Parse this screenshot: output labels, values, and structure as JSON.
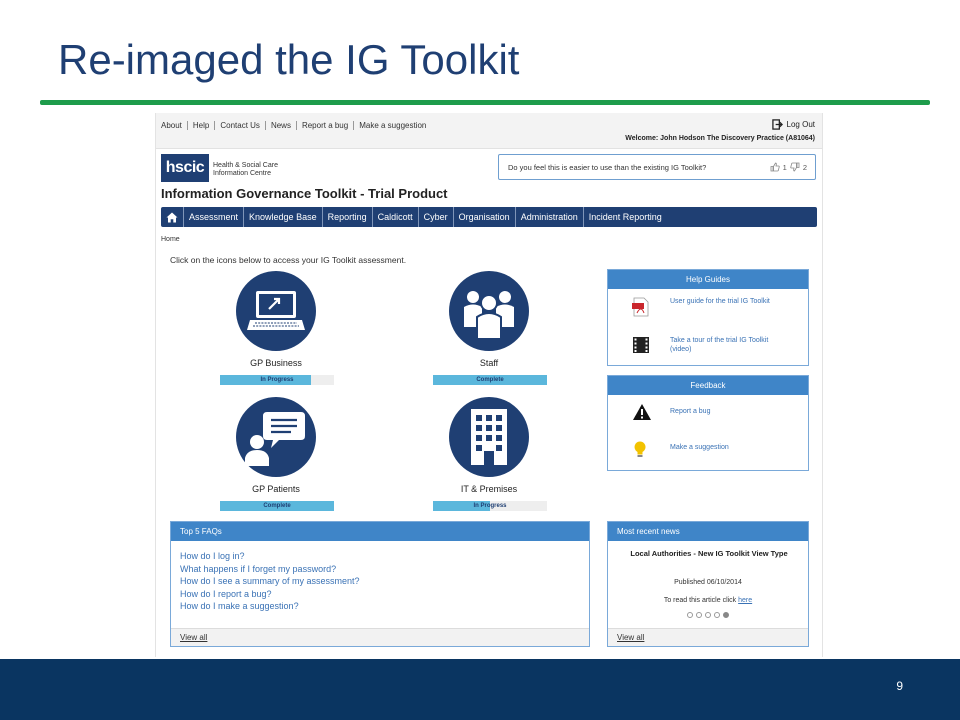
{
  "slide": {
    "title": "Re-imaged the IG Toolkit",
    "page_number": "9",
    "accent_color": "#1e9c4b",
    "footer_color": "#0a3561"
  },
  "top_links": [
    "About",
    "Help",
    "Contact Us",
    "News",
    "Report a bug",
    "Make a suggestion"
  ],
  "logout_label": "Log Out",
  "welcome_text": "Welcome:  John Hodson   The Discovery Practice (A81064)",
  "logo": {
    "mark": "hscic",
    "text_line1": "Health & Social Care",
    "text_line2": "Information Centre"
  },
  "survey": {
    "question": "Do you feel this is easier to use than the existing IG Toolkit?",
    "up_count": "1",
    "down_count": "2"
  },
  "app_title": "Information Governance Toolkit - Trial Product",
  "nav": {
    "home_icon": "home-icon",
    "items": [
      "Assessment",
      "Knowledge Base",
      "Reporting",
      "Caldicott",
      "Cyber",
      "Organisation",
      "Administration",
      "Incident Reporting"
    ]
  },
  "breadcrumb": "Home",
  "intro": "Click on the icons below to access your IG Toolkit assessment.",
  "tiles": [
    {
      "label": "GP Business",
      "icon": "laptop-icon",
      "status": "In Progress",
      "progress": 0.8
    },
    {
      "label": "Staff",
      "icon": "staff-group-icon",
      "status": "Complete",
      "progress": 1.0
    },
    {
      "label": "GP Patients",
      "icon": "patient-speech-icon",
      "status": "Complete",
      "progress": 1.0
    },
    {
      "label": "IT & Premises",
      "icon": "building-icon",
      "status": "In Progress",
      "progress": 0.5
    }
  ],
  "help_guides": {
    "title": "Help Guides",
    "items": [
      {
        "icon": "pdf-icon",
        "text": "User guide for the trial IG Toolkit"
      },
      {
        "icon": "film-icon",
        "text": "Take a tour of the trial IG Toolkit (video)"
      }
    ]
  },
  "feedback": {
    "title": "Feedback",
    "items": [
      {
        "icon": "warning-icon",
        "text": "Report a bug"
      },
      {
        "icon": "lightbulb-icon",
        "text": "Make a suggestion"
      }
    ]
  },
  "faqs": {
    "title": "Top 5 FAQs",
    "items": [
      "How do I log in?",
      "What happens if I forget my password?",
      "How do I see a summary of my assessment?",
      "How do I report a bug?",
      "How do I make a suggestion?"
    ],
    "view_all": "View all"
  },
  "news": {
    "title": "Most recent news",
    "headline": "Local Authorities - New IG Toolkit View Type",
    "published": "Published 06/10/2014",
    "read_prefix": "To read this article click ",
    "read_link": "here",
    "view_all": "View all"
  }
}
